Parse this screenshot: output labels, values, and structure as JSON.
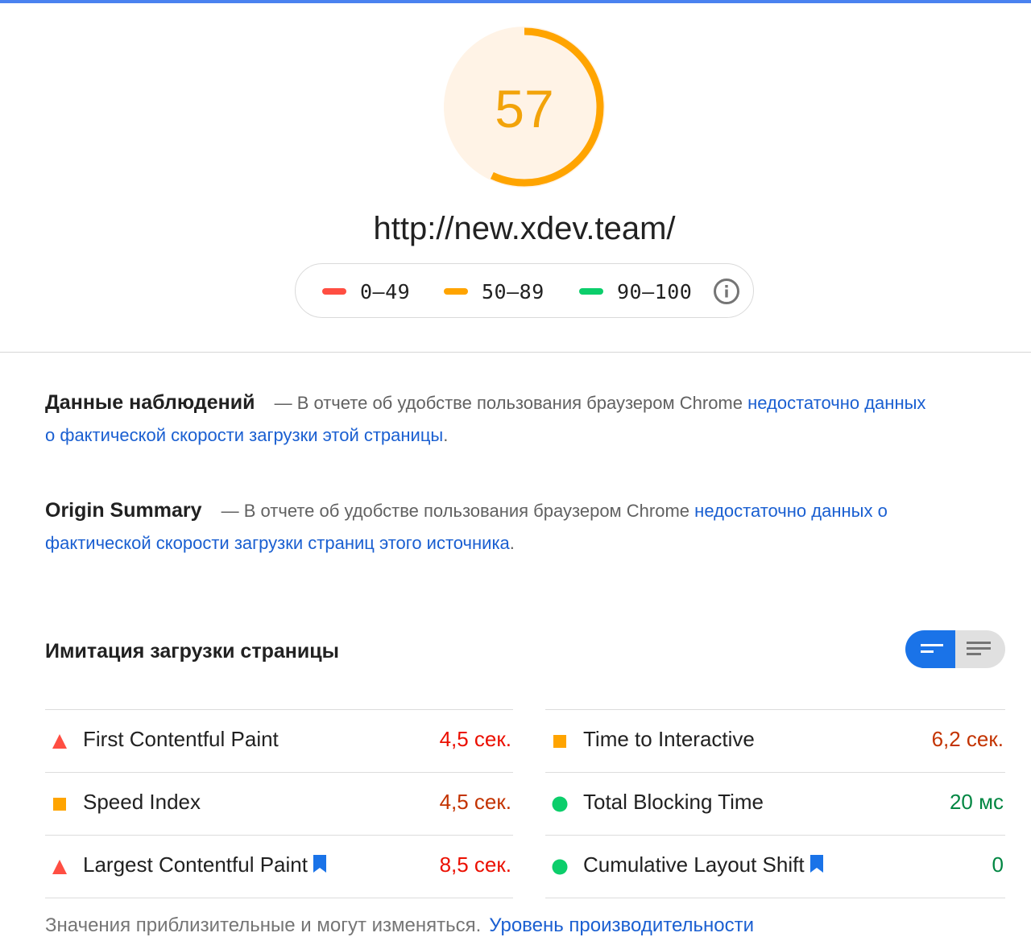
{
  "score": {
    "value": "57",
    "fraction": 0.57,
    "color": "#ffa400",
    "bg_color": "#fff3e6"
  },
  "url": "http://new.xdev.team/",
  "legend": {
    "items": [
      {
        "range": "0–49",
        "color": "#ff4e42"
      },
      {
        "range": "50–89",
        "color": "#ffa400"
      },
      {
        "range": "90–100",
        "color": "#0cce6b"
      }
    ],
    "info_icon": "info-icon"
  },
  "field_data": {
    "title": "Данные наблюдений",
    "text": "— В отчете об удобстве пользования браузером Chrome",
    "link": "недостаточно данных о фактической скорости загрузки этой страницы",
    "end": "."
  },
  "origin_summary": {
    "title": "Origin Summary",
    "text": "— В отчете об удобстве пользования браузером Chrome",
    "link": "недостаточно данных о фактической скорости загрузки страниц этого источника",
    "end": "."
  },
  "lab": {
    "title": "Имитация загрузки страницы",
    "toggle": {
      "left_icon": "compact-view-icon",
      "right_icon": "expanded-view-icon",
      "active": "left"
    }
  },
  "metrics": {
    "left": [
      {
        "label": "First Contentful Paint",
        "value": "4,5 сек.",
        "status": "fail",
        "bookmark": false
      },
      {
        "label": "Speed Index",
        "value": "4,5 сек.",
        "status": "average",
        "bookmark": false
      },
      {
        "label": "Largest Contentful Paint",
        "value": "8,5 сек.",
        "status": "fail",
        "bookmark": true
      }
    ],
    "right": [
      {
        "label": "Time to Interactive",
        "value": "6,2 сек.",
        "status": "average",
        "bookmark": false
      },
      {
        "label": "Total Blocking Time",
        "value": "20 мс",
        "status": "pass",
        "bookmark": false
      },
      {
        "label": "Cumulative Layout Shift",
        "value": "0",
        "status": "pass",
        "bookmark": true
      }
    ]
  },
  "status_colors": {
    "fail": "#eb0f00",
    "average": "#c33300",
    "pass": "#018642",
    "fail_icon": "#ff4e42",
    "average_icon": "#ffa400",
    "pass_icon": "#0cce6b",
    "bookmark": "#1a73e8"
  },
  "footnote": {
    "text": "Значения приблизительные и могут изменяться.",
    "link": "Уровень производительности"
  }
}
